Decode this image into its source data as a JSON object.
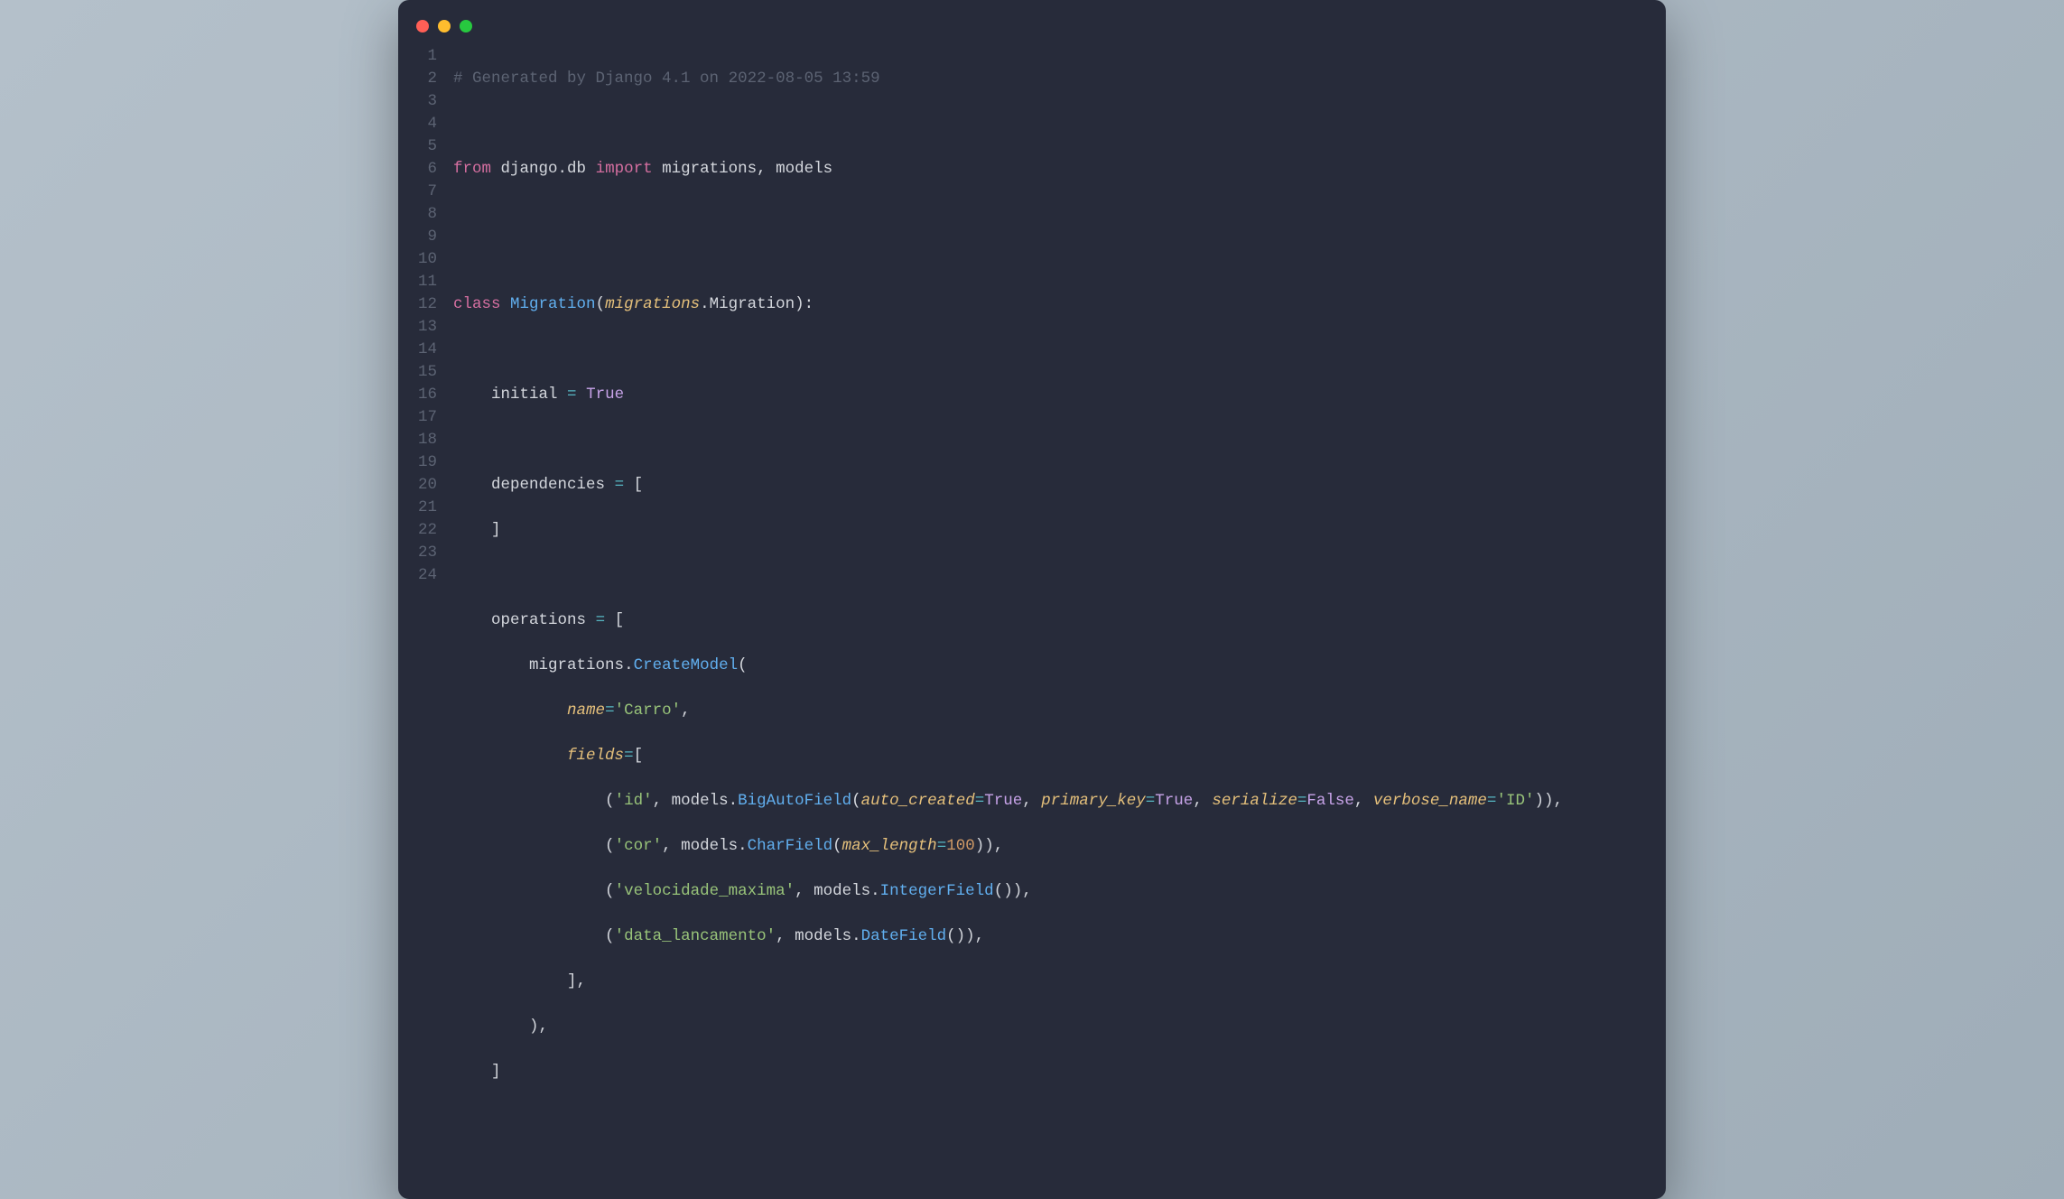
{
  "window": {
    "dots": [
      "close",
      "minimize",
      "zoom"
    ]
  },
  "code": {
    "language": "python",
    "lineNumbers": [
      "1",
      "2",
      "3",
      "4",
      "5",
      "6",
      "7",
      "8",
      "9",
      "10",
      "11",
      "12",
      "13",
      "14",
      "15",
      "16",
      "17",
      "18",
      "19",
      "20",
      "21",
      "22",
      "23",
      "24"
    ],
    "tokens": {
      "l1_comment": "# Generated by Django 4.1 on 2022-08-05 13:59",
      "l3_from": "from",
      "l3_mod": " django.db ",
      "l3_import": "import",
      "l3_names": " migrations, models",
      "l6_class": "class",
      "l6_name": " Migration",
      "l6_paren_open": "(",
      "l6_base_mod": "migrations",
      "l6_dot": ".",
      "l6_base_cls": "Migration",
      "l6_paren_close": "):",
      "l8_indent": "    ",
      "l8_attr": "initial",
      "l8_eq": " = ",
      "l8_val": "True",
      "l10_indent": "    ",
      "l10_attr": "dependencies",
      "l10_eq": " = ",
      "l10_open": "[",
      "l11_indent": "    ",
      "l11_close": "]",
      "l13_indent": "    ",
      "l13_attr": "operations",
      "l13_eq": " = ",
      "l13_open": "[",
      "l14_indent": "        ",
      "l14_mod": "migrations",
      "l14_dot": ".",
      "l14_cls": "CreateModel",
      "l14_open": "(",
      "l15_indent": "            ",
      "l15_param": "name",
      "l15_eq": "=",
      "l15_str": "'Carro'",
      "l15_comma": ",",
      "l16_indent": "            ",
      "l16_param": "fields",
      "l16_eq": "=",
      "l16_open": "[",
      "l17_indent": "                ",
      "l17_open": "(",
      "l17_str1": "'id'",
      "l17_comma1": ", ",
      "l17_mod": "models",
      "l17_dot": ".",
      "l17_cls": "BigAutoField",
      "l17_open2": "(",
      "l17_p1": "auto_created",
      "l17_eq1": "=",
      "l17_v1": "True",
      "l17_c1": ", ",
      "l17_p2": "primary_key",
      "l17_eq2": "=",
      "l17_v2": "True",
      "l17_c2": ", ",
      "l17_p3": "serialize",
      "l17_eq3": "=",
      "l17_v3": "False",
      "l17_c3": ", ",
      "l17_p4": "verbose_name",
      "l17_eq4": "=",
      "l17_v4": "'ID'",
      "l17_close": ")),",
      "l18_indent": "                ",
      "l18_open": "(",
      "l18_str": "'cor'",
      "l18_comma": ", ",
      "l18_mod": "models",
      "l18_dot": ".",
      "l18_cls": "CharField",
      "l18_open2": "(",
      "l18_p1": "max_length",
      "l18_eq1": "=",
      "l18_v1": "100",
      "l18_close": ")),",
      "l19_indent": "                ",
      "l19_open": "(",
      "l19_str": "'velocidade_maxima'",
      "l19_comma": ", ",
      "l19_mod": "models",
      "l19_dot": ".",
      "l19_cls": "IntegerField",
      "l19_open2": "()",
      "l19_close": "),",
      "l20_indent": "                ",
      "l20_open": "(",
      "l20_str": "'data_lancamento'",
      "l20_comma": ", ",
      "l20_mod": "models",
      "l20_dot": ".",
      "l20_cls": "DateField",
      "l20_open2": "()",
      "l20_close": "),",
      "l21_indent": "            ",
      "l21_close": "],",
      "l22_indent": "        ",
      "l22_close": "),",
      "l23_indent": "    ",
      "l23_close": "]"
    }
  }
}
